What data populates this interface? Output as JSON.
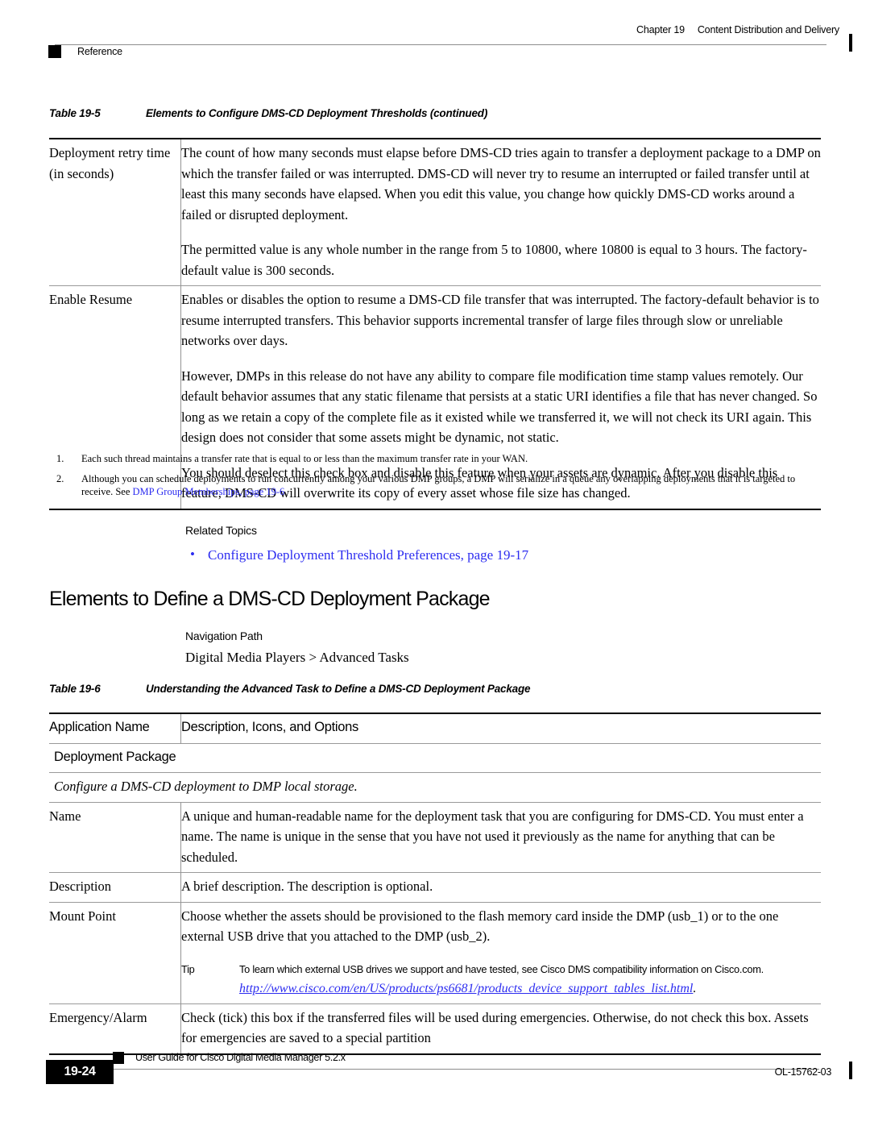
{
  "header": {
    "chapter_number": "Chapter 19",
    "chapter_title": "Content Distribution and Delivery",
    "section_marker": "Reference"
  },
  "table_19_5": {
    "caption_number": "Table 19-5",
    "caption_title": "Elements to Configure DMS-CD Deployment Thresholds (continued)",
    "rows": [
      {
        "label": "Deployment retry time (in seconds)",
        "paragraphs": [
          "The count of how many seconds must elapse before DMS-CD tries again to transfer a deployment package to a DMP on which the transfer failed or was interrupted. DMS-CD will never try to resume an interrupted or failed transfer until at least this many seconds have elapsed. When you edit this value, you change how quickly DMS-CD works around a failed or disrupted deployment.",
          "The permitted value is any whole number in the range from 5 to 10800, where 10800 is equal to 3 hours. The factory-default value is 300 seconds."
        ]
      },
      {
        "label": "Enable Resume",
        "paragraphs": [
          "Enables or disables the option to resume a DMS-CD file transfer that was interrupted. The factory-default behavior is to resume interrupted transfers. This behavior supports incremental transfer of large files through slow or unreliable networks over days.",
          "However, DMPs in this release do not have any ability to compare file modification time stamp values remotely. Our default behavior assumes that any static filename that persists at a static URI identifies a file that has never changed. So long as we retain a copy of the complete file as it existed while we transferred it, we will not check its URI again. This design does not consider that some assets might be dynamic, not static.",
          "You should deselect this check box and disable this feature when your assets are dynamic. After you disable this feature, DMS-CD will overwrite its copy of every asset whose file size has changed."
        ]
      }
    ]
  },
  "footnotes": [
    {
      "number": "1.",
      "text": "Each such thread maintains a transfer rate that is equal to or less than the maximum transfer rate in your WAN.",
      "link_text": "",
      "text_after": ""
    },
    {
      "number": "2.",
      "text": "Although you can schedule deployments to run concurrently among your various DMP groups, a DMP will serialize in a queue any overlapping deployments that it is targeted to receive. See ",
      "link_text": "DMP Group Memberships, page 19-6",
      "text_after": "."
    }
  ],
  "related_topics": {
    "heading": "Related Topics",
    "bullet": "•",
    "items": [
      "Configure Deployment Threshold Preferences, page 19-17"
    ]
  },
  "section": {
    "heading": "Elements to Define a DMS-CD Deployment Package",
    "navigation_label": "Navigation Path",
    "navigation_path": "Digital Media Players > Advanced Tasks"
  },
  "table_19_6": {
    "caption_number": "Table 19-6",
    "caption_title": "Understanding the Advanced Task to Define a DMS-CD Deployment Package",
    "headers": {
      "col1": "Application Name",
      "col2": "Description, Icons, and Options"
    },
    "group_row": "Deployment Package",
    "group_description": "Configure a DMS-CD deployment to DMP local storage.",
    "rows": [
      {
        "label": "Name",
        "body": "A unique and human-readable name for the deployment task that you are configuring for DMS-CD. You must enter a name. The name is unique in the sense that you have not used it previously as the name for anything that can be scheduled."
      },
      {
        "label": "Description",
        "body": "A brief description. The description is optional."
      },
      {
        "label": "Mount Point",
        "body": "Choose whether the assets should be provisioned to the flash memory card inside the DMP (usb_1) or to the one external USB drive that you attached to the DMP (usb_2).",
        "tip_label": "Tip",
        "tip_text": "To learn which external USB drives we support and have tested, see Cisco DMS compatibility information on Cisco.com.",
        "tip_url": "http://www.cisco.com/en/US/products/ps6681/products_device_support_tables_list.html",
        "tip_url_trailing": "."
      },
      {
        "label": "Emergency/Alarm",
        "body": "Check (tick) this box if the transferred files will be used during emergencies. Otherwise, do not check this box. Assets for emergencies are saved to a special partition"
      }
    ]
  },
  "footer": {
    "guide_title": "User Guide for Cisco Digital Media Manager 5.2.x",
    "page_number": "19-24",
    "doc_number": "OL-15762-03"
  },
  "colors": {
    "link": "#2d2df0",
    "rule_heavy": "#000000",
    "rule_light": "#9a9a9a"
  }
}
